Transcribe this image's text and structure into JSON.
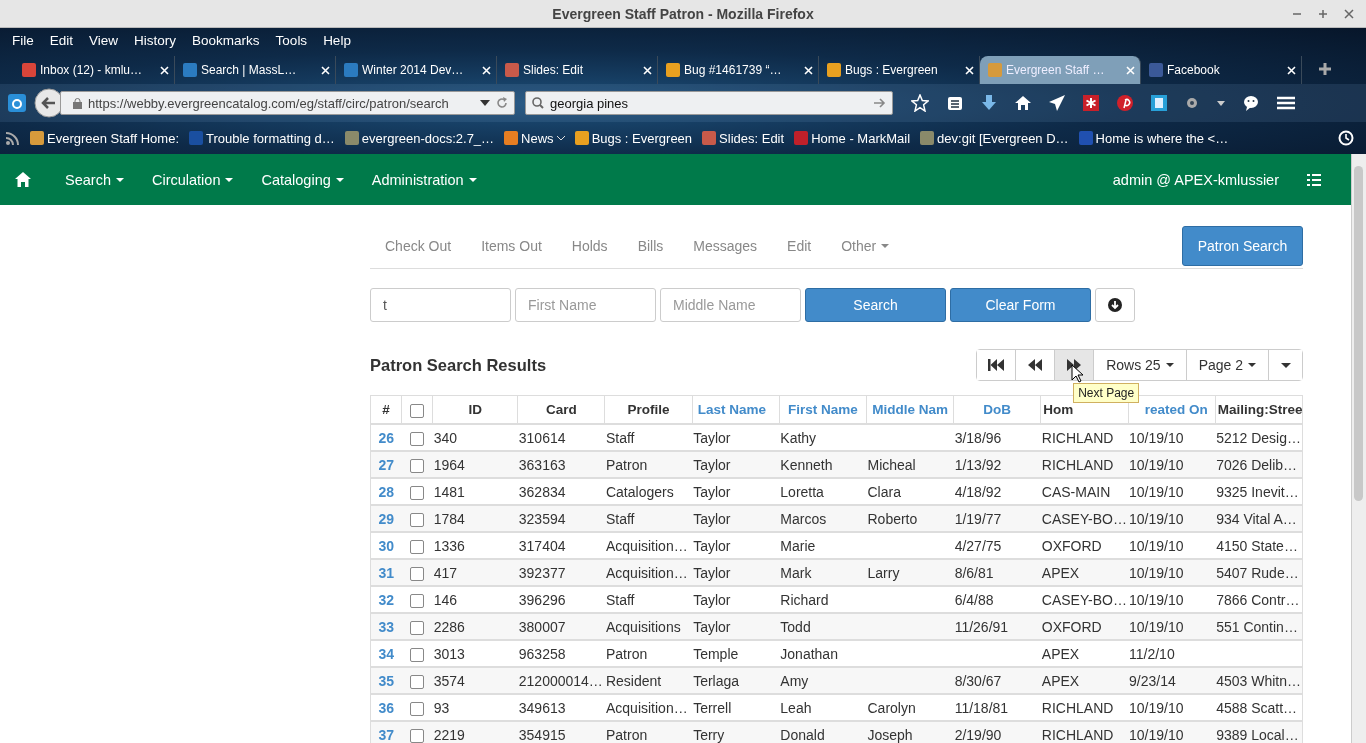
{
  "window": {
    "title": "Evergreen Staff Patron - Mozilla Firefox"
  },
  "menu": [
    "File",
    "Edit",
    "View",
    "History",
    "Bookmarks",
    "Tools",
    "Help"
  ],
  "tabs": [
    {
      "label": "Inbox (12) - kmlu…",
      "color": "#d9453a",
      "selected": false
    },
    {
      "label": "Search | MassL…",
      "color": "#2b7bc0",
      "selected": false
    },
    {
      "label": "Winter 2014 Dev…",
      "color": "#2b7bc0",
      "selected": false
    },
    {
      "label": "Slides: Edit",
      "color": "#c85a4a",
      "selected": false
    },
    {
      "label": "Bug #1461739 “…",
      "color": "#e8a020",
      "selected": false
    },
    {
      "label": "Bugs : Evergreen",
      "color": "#e8a020",
      "selected": false
    },
    {
      "label": "Evergreen Staff …",
      "color": "#d69a3c",
      "selected": true
    },
    {
      "label": "Facebook",
      "color": "#3b5998",
      "selected": false
    }
  ],
  "address": {
    "value": "https://webby.evergreencatalog.com/eg/staff/circ/patron/search"
  },
  "search": {
    "value": "georgia pines"
  },
  "bookmarks": [
    {
      "label": "Evergreen Staff Home:",
      "color": "#d69a3c",
      "dropdown": false
    },
    {
      "label": "Trouble formatting d…",
      "color": "#1a4fa0",
      "dropdown": false
    },
    {
      "label": "evergreen-docs:2.7_…",
      "color": "#8a8a6a",
      "dropdown": false
    },
    {
      "label": "News",
      "color": "#e67e22",
      "dropdown": true
    },
    {
      "label": "Bugs : Evergreen",
      "color": "#e8a020",
      "dropdown": false
    },
    {
      "label": "Slides: Edit",
      "color": "#c85a4a",
      "dropdown": false
    },
    {
      "label": "Home - MarkMail",
      "color": "#c0202a",
      "dropdown": false
    },
    {
      "label": "dev:git [Evergreen D…",
      "color": "#8a8a6a",
      "dropdown": false
    },
    {
      "label": "Home is where the <…",
      "color": "#2050b0",
      "dropdown": false
    }
  ],
  "navbar": {
    "items": [
      "Search",
      "Circulation",
      "Cataloging",
      "Administration"
    ],
    "user": "admin @ APEX-kmlussier"
  },
  "patron_tabs": [
    {
      "label": "Check Out",
      "dropdown": false
    },
    {
      "label": "Items Out",
      "dropdown": false
    },
    {
      "label": "Holds",
      "dropdown": false
    },
    {
      "label": "Bills",
      "dropdown": false
    },
    {
      "label": "Messages",
      "dropdown": false
    },
    {
      "label": "Edit",
      "dropdown": false
    },
    {
      "label": "Other",
      "dropdown": true
    }
  ],
  "patron_search_button": "Patron Search",
  "form": {
    "last_name": {
      "value": "t"
    },
    "first_name": {
      "placeholder": "First Name"
    },
    "middle_name": {
      "placeholder": "Middle Name"
    },
    "search_button": "Search",
    "clear_button": "Clear Form"
  },
  "results": {
    "title": "Patron Search Results",
    "pager": {
      "rows": "Rows 25",
      "page": "Page 2",
      "tooltip": "Next Page"
    },
    "all_checked": false,
    "number_header": "#",
    "columns": [
      {
        "label": "ID",
        "sortable": false
      },
      {
        "label": "Card",
        "sortable": false
      },
      {
        "label": "Profile",
        "sortable": false
      },
      {
        "label": "Last Name",
        "sortable": true
      },
      {
        "label": "First Name",
        "sortable": true
      },
      {
        "label": "Middle Nam",
        "sortable": true
      },
      {
        "label": "DoB",
        "sortable": true
      },
      {
        "label": "Hom",
        "sortable": false
      },
      {
        "label": "reated On",
        "sortable": true
      },
      {
        "label": "Mailing:Stree",
        "sortable": false
      }
    ],
    "rows": [
      {
        "num": "26",
        "checked": false,
        "cells": [
          "340",
          "310614",
          "Staff",
          "Taylor",
          "Kathy",
          "",
          "3/18/96",
          "RICHLAND",
          "10/19/10",
          "5212 Desig…"
        ]
      },
      {
        "num": "27",
        "checked": false,
        "cells": [
          "1964",
          "363163",
          "Patron",
          "Taylor",
          "Kenneth",
          "Micheal",
          "1/13/92",
          "RICHLAND",
          "10/19/10",
          "7026 Delib…"
        ]
      },
      {
        "num": "28",
        "checked": false,
        "cells": [
          "1481",
          "362834",
          "Catalogers",
          "Taylor",
          "Loretta",
          "Clara",
          "4/18/92",
          "CAS-MAIN",
          "10/19/10",
          "9325 Inevit…"
        ]
      },
      {
        "num": "29",
        "checked": false,
        "cells": [
          "1784",
          "323594",
          "Staff",
          "Taylor",
          "Marcos",
          "Roberto",
          "1/19/77",
          "CASEY-BO…",
          "10/19/10",
          "934 Vital A…"
        ]
      },
      {
        "num": "30",
        "checked": false,
        "cells": [
          "1336",
          "317404",
          "Acquisition…",
          "Taylor",
          "Marie",
          "",
          "4/27/75",
          "OXFORD",
          "10/19/10",
          "4150 State…"
        ]
      },
      {
        "num": "31",
        "checked": false,
        "cells": [
          "417",
          "392377",
          "Acquisition…",
          "Taylor",
          "Mark",
          "Larry",
          "8/6/81",
          "APEX",
          "10/19/10",
          "5407 Rude…"
        ]
      },
      {
        "num": "32",
        "checked": false,
        "cells": [
          "146",
          "396296",
          "Staff",
          "Taylor",
          "Richard",
          "",
          "6/4/88",
          "CASEY-BO…",
          "10/19/10",
          "7866 Contr…"
        ]
      },
      {
        "num": "33",
        "checked": false,
        "cells": [
          "2286",
          "380007",
          "Acquisitions",
          "Taylor",
          "Todd",
          "",
          "11/26/91",
          "OXFORD",
          "10/19/10",
          "551 Contin…"
        ]
      },
      {
        "num": "34",
        "checked": false,
        "cells": [
          "3013",
          "963258",
          "Patron",
          "Temple",
          "Jonathan",
          "",
          "",
          "APEX",
          "11/2/10",
          ""
        ]
      },
      {
        "num": "35",
        "checked": false,
        "cells": [
          "3574",
          "212000014…",
          "Resident",
          "Terlaga",
          "Amy",
          "",
          "8/30/67",
          "APEX",
          "9/23/14",
          "4503 Whitn…"
        ]
      },
      {
        "num": "36",
        "checked": false,
        "cells": [
          "93",
          "349613",
          "Acquisition…",
          "Terrell",
          "Leah",
          "Carolyn",
          "11/18/81",
          "RICHLAND",
          "10/19/10",
          "4588 Scatt…"
        ]
      },
      {
        "num": "37",
        "checked": false,
        "cells": [
          "2219",
          "354915",
          "Patron",
          "Terry",
          "Donald",
          "Joseph",
          "2/19/90",
          "RICHLAND",
          "10/19/10",
          "9389 Local…"
        ]
      }
    ]
  }
}
